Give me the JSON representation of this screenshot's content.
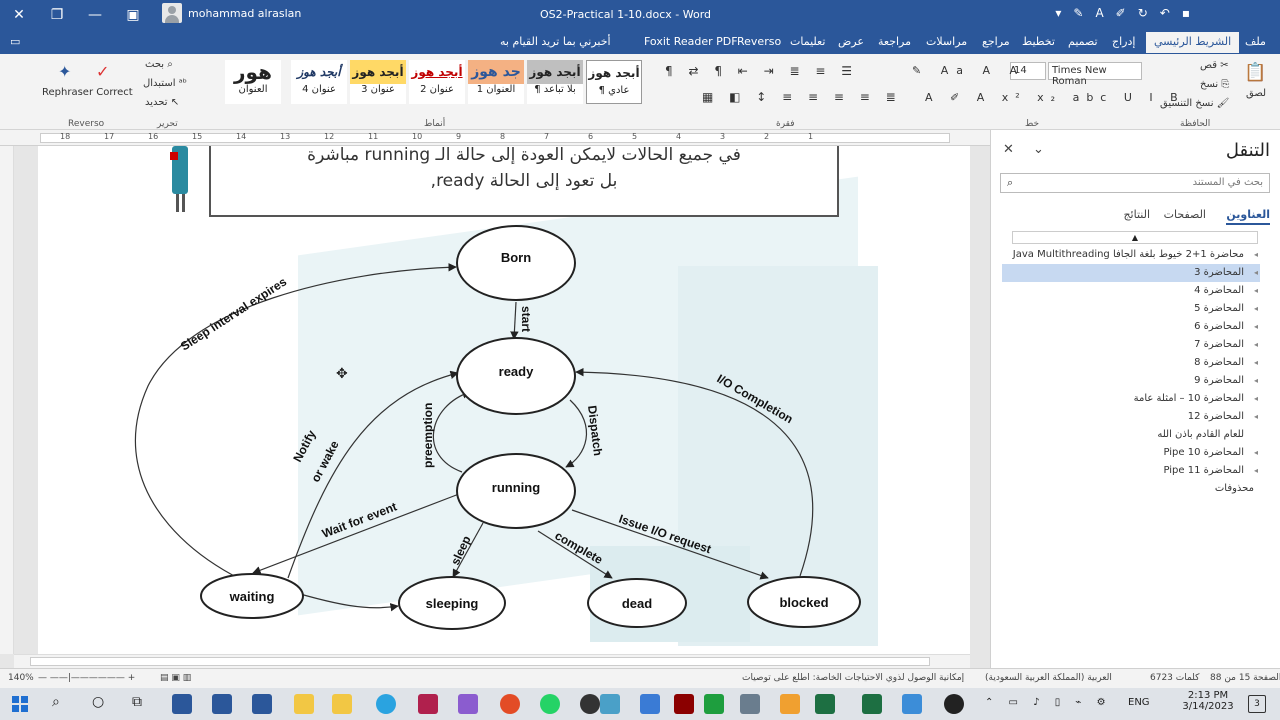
{
  "titlebar": {
    "user_name": "mohammad alraslan",
    "doc_title": "OS2-Practical 1-10.docx  -  Word"
  },
  "tabs": [
    "ملف",
    "الشريط الرئيسي",
    "إدراج",
    "تصميم",
    "تخطيط",
    "مراجع",
    "مراسلات",
    "مراجعة",
    "عرض",
    "تعليمات",
    "Reverso",
    "Foxit Reader PDF",
    "أخبرني بما تريد القيام به"
  ],
  "ribbon": {
    "clipboard": {
      "paste": "لصق",
      "cut": "قص",
      "copy": "نسخ",
      "format_painter": "نسخ التنسيق",
      "label": "الحافظة"
    },
    "font": {
      "name": "Times New Roman",
      "size": "14",
      "label": "خط"
    },
    "paragraph_label": "فقرة",
    "styles": [
      {
        "sample": "أبجد هوز",
        "name": "¶ عادي"
      },
      {
        "sample": "أبجد هوز",
        "name": "¶ بلا تباعد"
      },
      {
        "sample": "جد هوز",
        "name": "العنوان 1"
      },
      {
        "sample": "أبجد هوز",
        "name": "عنوان 2"
      },
      {
        "sample": "أبجد هوز",
        "name": "عنوان 3"
      },
      {
        "sample": "أبجد هوز",
        "name": "عنوان 4"
      },
      {
        "sample": "هور",
        "name": "العنوان"
      }
    ],
    "styles_label": "أنماط",
    "editing": {
      "find": "بحث",
      "replace": "استبدال",
      "select": "تحديد",
      "label": "تحرير"
    },
    "reverso": {
      "button": "Rephraser Correct",
      "label": "Reverso"
    }
  },
  "ruler": [
    "18",
    "17",
    "16",
    "15",
    "14",
    "13",
    "12",
    "11",
    "10",
    "9",
    "8",
    "7",
    "6",
    "5",
    "4",
    "3",
    "2",
    "1"
  ],
  "document": {
    "textbox_line1": "في جميع الحالات لايمكن العودة إلى حالة الـ  running مباشرة",
    "textbox_line2": "بل تعود إلى الحالة ready,"
  },
  "diagram": {
    "nodes": {
      "born": "Born",
      "ready": "ready",
      "running": "running",
      "waiting": "waiting",
      "sleeping": "sleeping",
      "dead": "dead",
      "blocked": "blocked"
    },
    "edges": {
      "start": "start",
      "sleep_expires": "Sleep interval expires",
      "notify": "Notify",
      "or_wake": "or wake",
      "preemption": "preemption",
      "dispatch": "Dispatch",
      "io_completion": "I/O Completion",
      "wait_event": "Wait for event",
      "sleep": "sleep",
      "complete": "complete",
      "issue_io": "Issue I/O request"
    }
  },
  "navpane": {
    "title": "التنقل",
    "search_placeholder": "بحث في المستند",
    "tabs": {
      "headings": "العناوين",
      "pages": "الصفحات",
      "results": "النتائج"
    },
    "items": [
      "محاضرة 1+2 خيوط بلغة الجافا Java Multithreading",
      "المحاضرة 3",
      "المحاضرة 4",
      "المحاضرة 5",
      "المحاضرة 6",
      "المحاضرة 7",
      "المحاضرة 8",
      "المحاضرة 9",
      "المحاضرة 10 – امثلة عامة",
      "المحاضرة 12",
      "للعام القادم باذن الله",
      "المحاضرة 10  Pipe",
      "المحاضرة 11  Pipe",
      "محذوفات"
    ]
  },
  "status": {
    "page": "الصفحة 15 من 88",
    "words": "6723 كلمات",
    "language": "العربية (المملكة العربية السعودية)",
    "accessibility": "إمكانية الوصول لذوي الاحتياجات الخاصة: اطلع على توصيات",
    "zoom": "140%"
  },
  "taskbar": {
    "lang": "ENG",
    "time": "2:13 PM",
    "date": "3/14/2023",
    "notif_count": "3"
  },
  "colors": {
    "word_blue": "#2b579a",
    "selected_item": "#c7d9f1"
  }
}
